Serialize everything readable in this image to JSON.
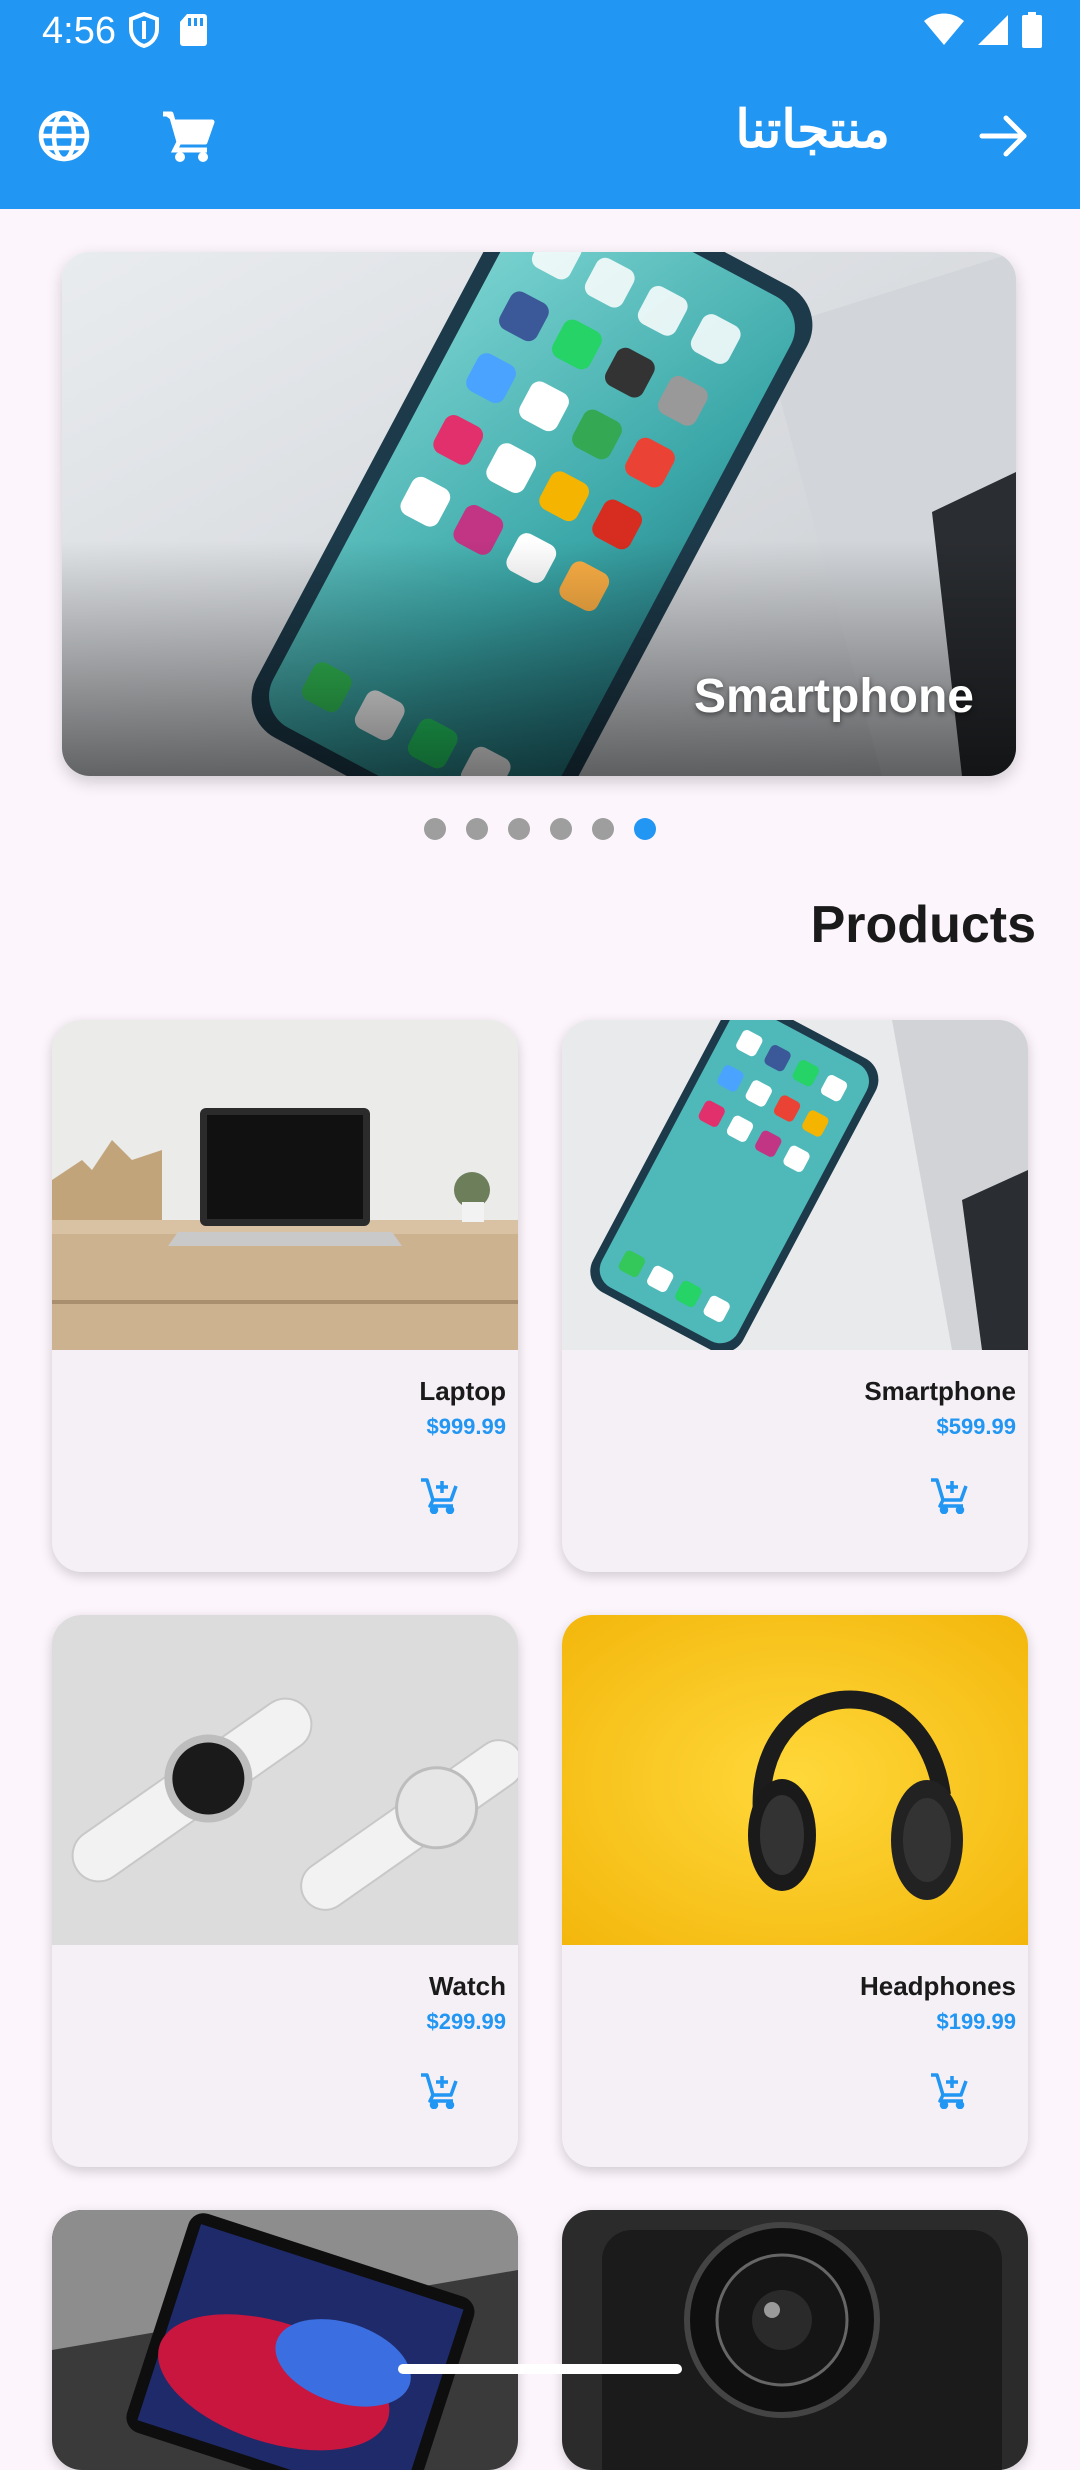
{
  "status": {
    "time": "4:56"
  },
  "appbar": {
    "title": "منتجاتنا",
    "icons": [
      "globe-icon",
      "cart-icon",
      "arrow-forward-icon"
    ]
  },
  "carousel": {
    "caption": "Smartphone",
    "dot_count": 6,
    "active_index": 5
  },
  "section": {
    "title": "Products"
  },
  "products": [
    {
      "name": "Laptop",
      "price": "$999.99"
    },
    {
      "name": "Smartphone",
      "price": "$599.99"
    },
    {
      "name": "Watch",
      "price": "$299.99"
    },
    {
      "name": "Headphones",
      "price": "$199.99"
    }
  ],
  "colors": {
    "accent": "#2196f3",
    "background": "#fcf6fc",
    "card": "#f5f0f6"
  }
}
